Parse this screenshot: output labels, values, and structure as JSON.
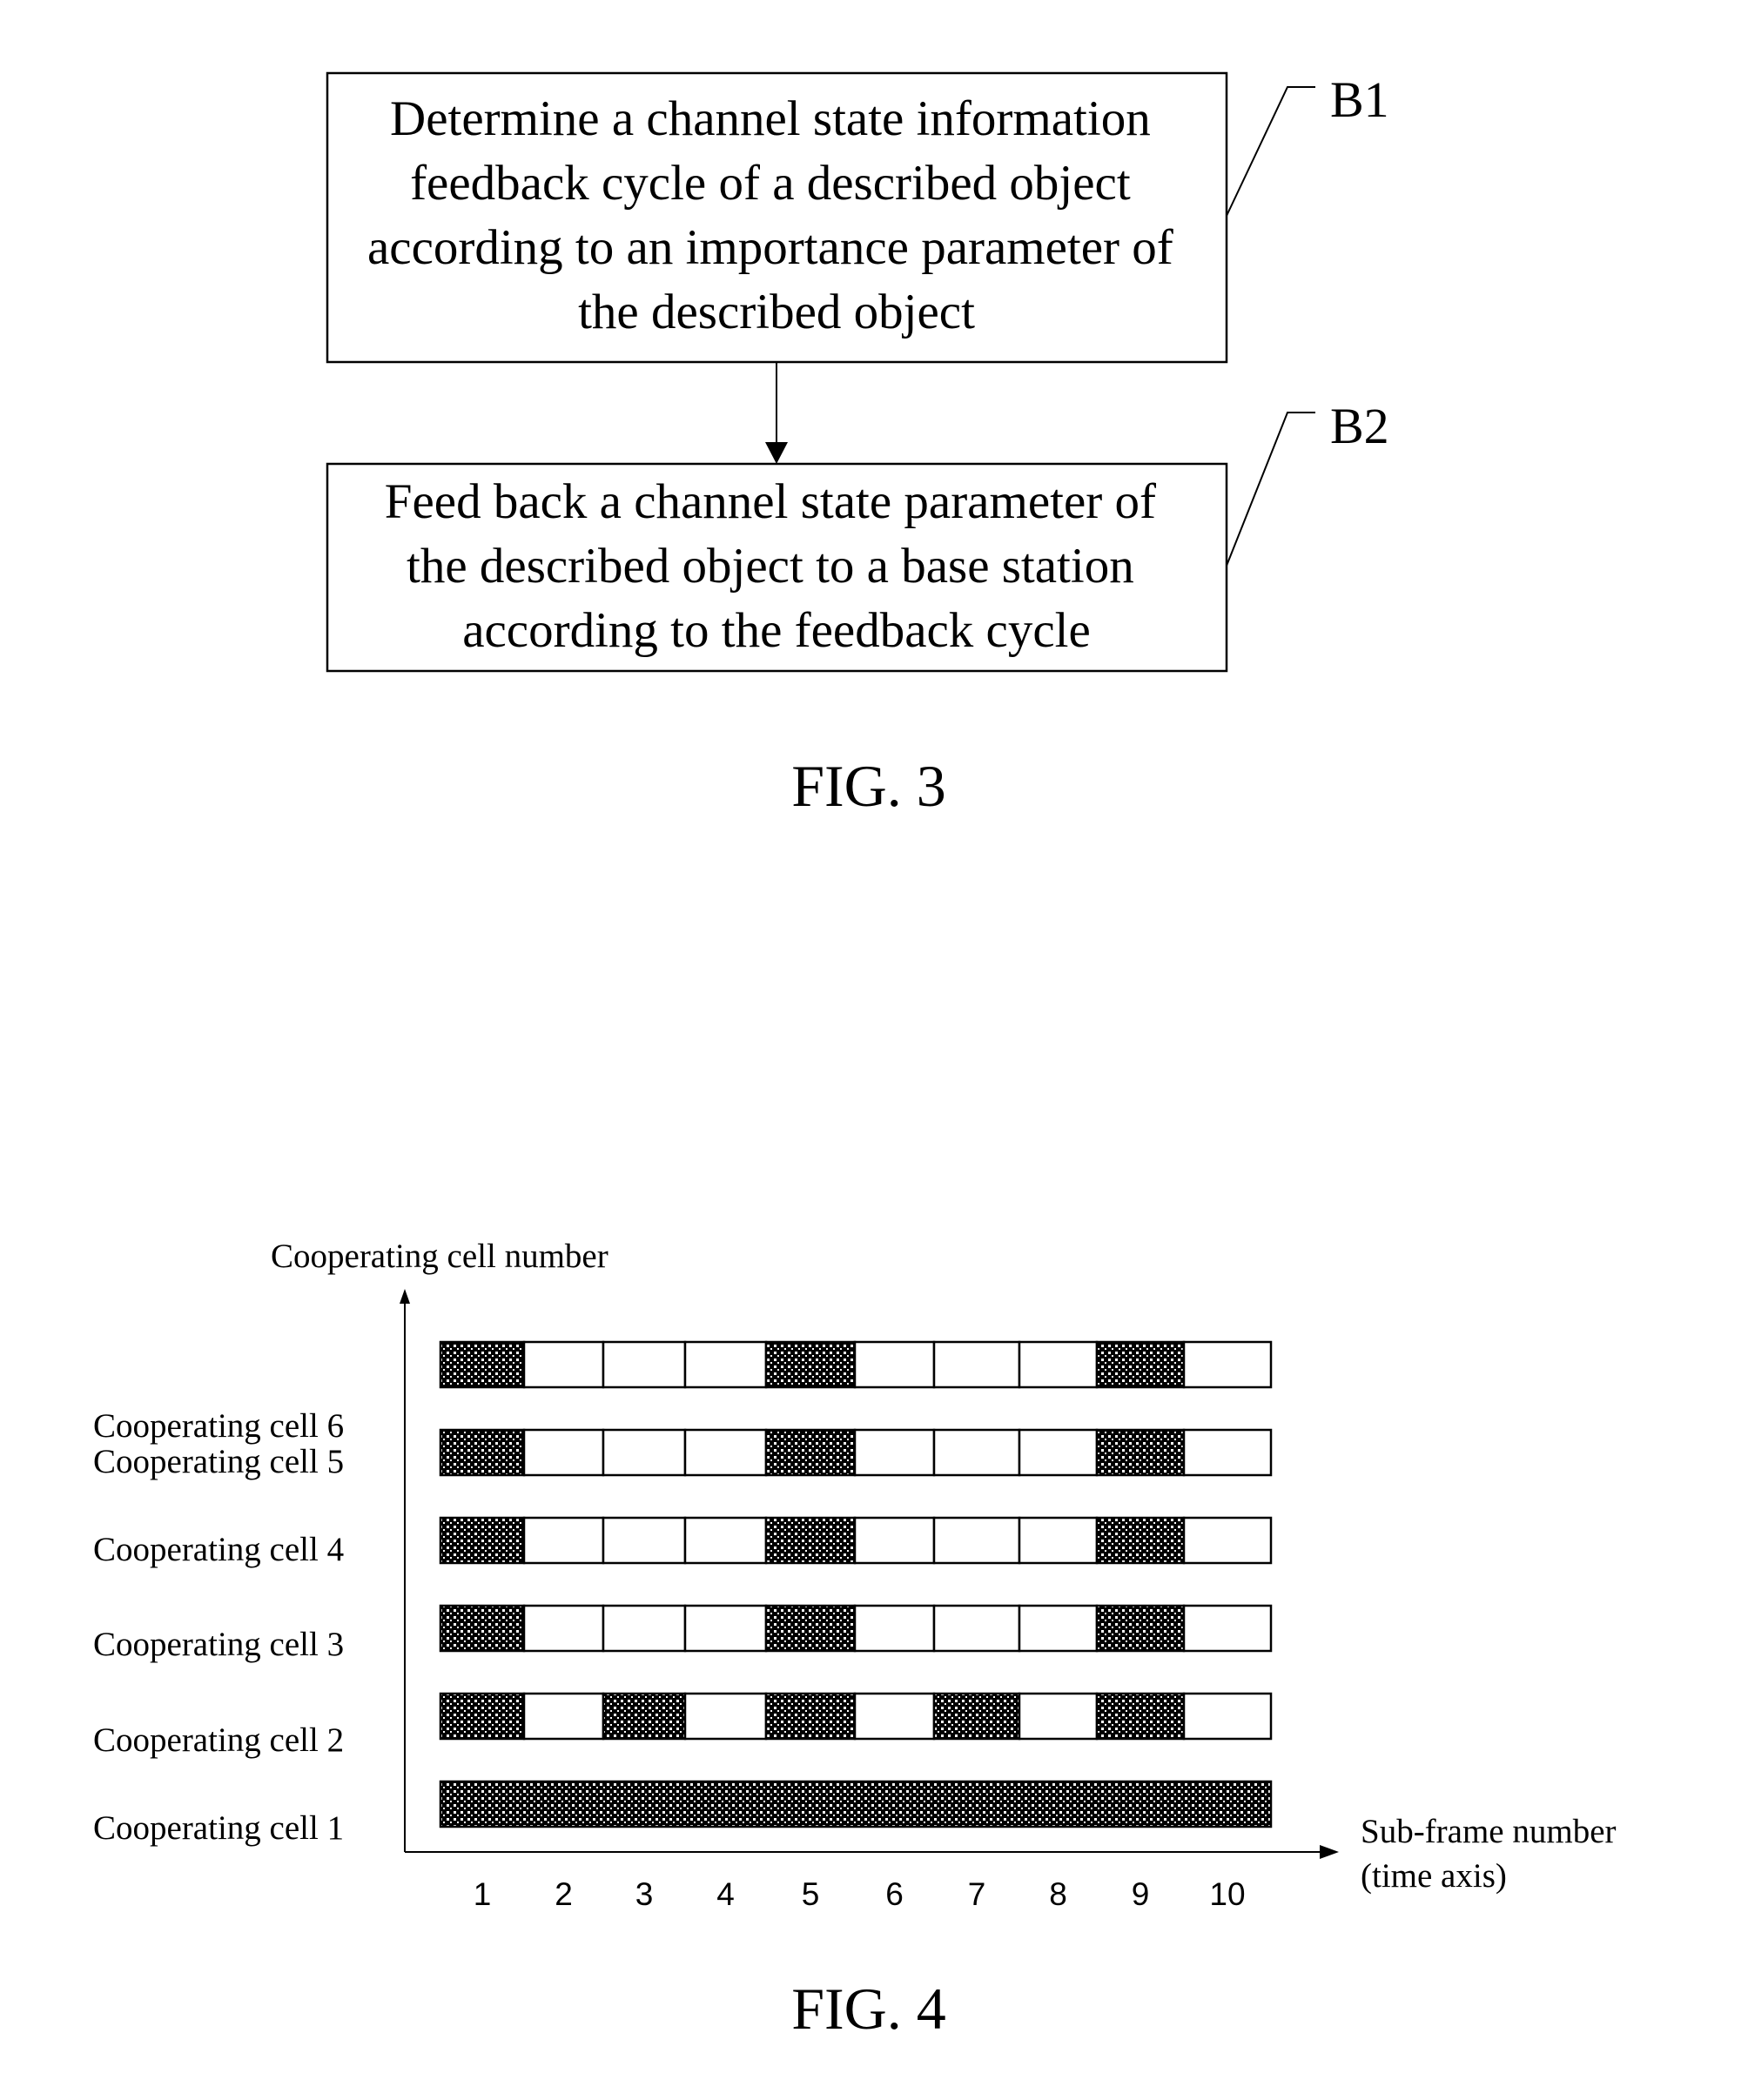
{
  "fig3": {
    "caption": "FIG. 3",
    "steps": [
      {
        "id": "B1",
        "label": "B1",
        "lines": [
          "Determine a channel state information",
          "feedback cycle of a described object",
          "according to an importance parameter of",
          "the described object"
        ]
      },
      {
        "id": "B2",
        "label": "B2",
        "lines": [
          "Feed back a channel state parameter of",
          "the described object to a base station",
          "according to the feedback cycle"
        ]
      }
    ]
  },
  "fig4": {
    "caption": "FIG. 4"
  },
  "chart_data": {
    "type": "heatmap",
    "title": "",
    "ylabel": "Cooperating cell number",
    "xlabel": "Sub-frame number",
    "xlabel_line2": "(time axis)",
    "categories": [
      "1",
      "2",
      "3",
      "4",
      "5",
      "6",
      "7",
      "8",
      "9",
      "10"
    ],
    "grid": false,
    "legend": "none",
    "value_meaning": "1 = shaded (channel state feedback in sub-frame), 0 = blank",
    "rows": [
      {
        "name": "Cooperating cell 6",
        "values": [
          1,
          0,
          0,
          0,
          1,
          0,
          0,
          0,
          1,
          0
        ]
      },
      {
        "name": "Cooperating cell 5",
        "values": [
          1,
          0,
          0,
          0,
          1,
          0,
          0,
          0,
          1,
          0
        ]
      },
      {
        "name": "Cooperating cell 4",
        "values": [
          1,
          0,
          0,
          0,
          1,
          0,
          0,
          0,
          1,
          0
        ]
      },
      {
        "name": "Cooperating cell 3",
        "values": [
          1,
          0,
          0,
          0,
          1,
          0,
          0,
          0,
          1,
          0
        ]
      },
      {
        "name": "Cooperating cell 2",
        "values": [
          1,
          0,
          1,
          0,
          1,
          0,
          1,
          0,
          1,
          0
        ]
      },
      {
        "name": "Cooperating cell 1",
        "values": [
          1,
          1,
          1,
          1,
          1,
          1,
          1,
          1,
          1,
          1
        ]
      }
    ]
  }
}
